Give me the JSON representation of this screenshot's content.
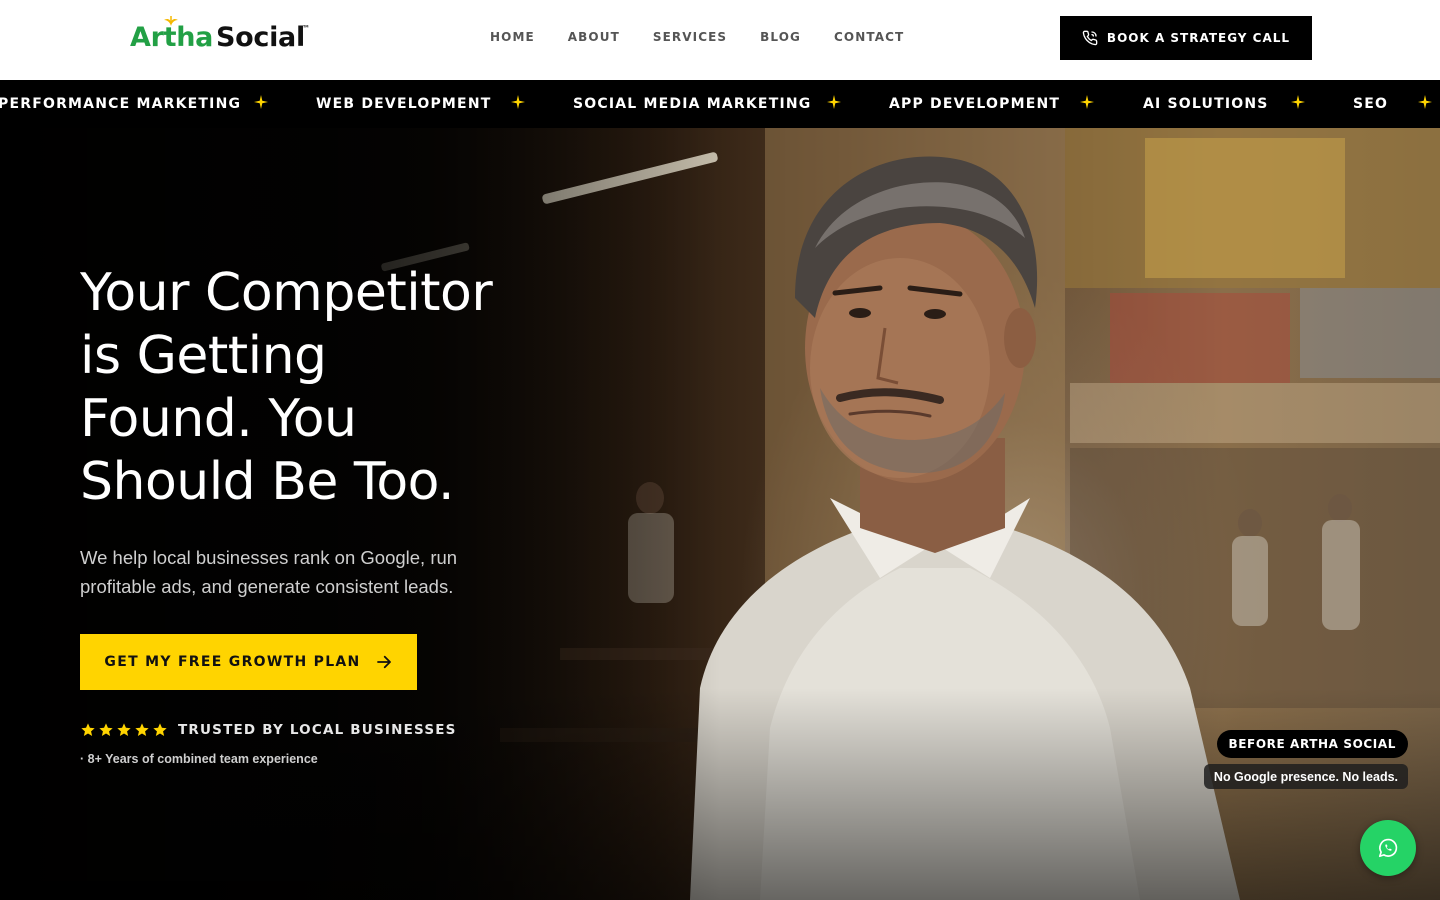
{
  "brand": {
    "name_part1": "Artha",
    "name_part2": "Social",
    "trademark": "™",
    "colors": {
      "green": "#22a045",
      "accent_yellow": "#ffd400"
    }
  },
  "nav": {
    "items": [
      "HOME",
      "ABOUT",
      "SERVICES",
      "BLOG",
      "CONTACT"
    ]
  },
  "header_cta": {
    "label": "BOOK A STRATEGY CALL",
    "icon": "phone-icon"
  },
  "marquee": {
    "items": [
      "PERFORMANCE MARKETING",
      "WEB DEVELOPMENT",
      "SOCIAL MEDIA MARKETING",
      "APP DEVELOPMENT",
      "AI SOLUTIONS",
      "SEO"
    ],
    "separator_icon": "sparkle-icon"
  },
  "hero": {
    "headline_lines": [
      "Your Competitor",
      "is Getting",
      "Found. You",
      "Should Be Too."
    ],
    "subheadline": "We help local businesses rank on Google, run profitable ads, and generate consistent leads.",
    "cta_label": "GET MY FREE GROWTH PLAN",
    "cta_icon": "arrow-right-icon",
    "rating_stars": 5,
    "trust_label": "TRUSTED BY LOCAL BUSINESSES",
    "experience_note": "· 8+ Years of combined team experience",
    "before_badge": "BEFORE ARTHA SOCIAL",
    "before_note": "No Google presence. No leads."
  },
  "floating": {
    "whatsapp_icon": "whatsapp-icon"
  }
}
